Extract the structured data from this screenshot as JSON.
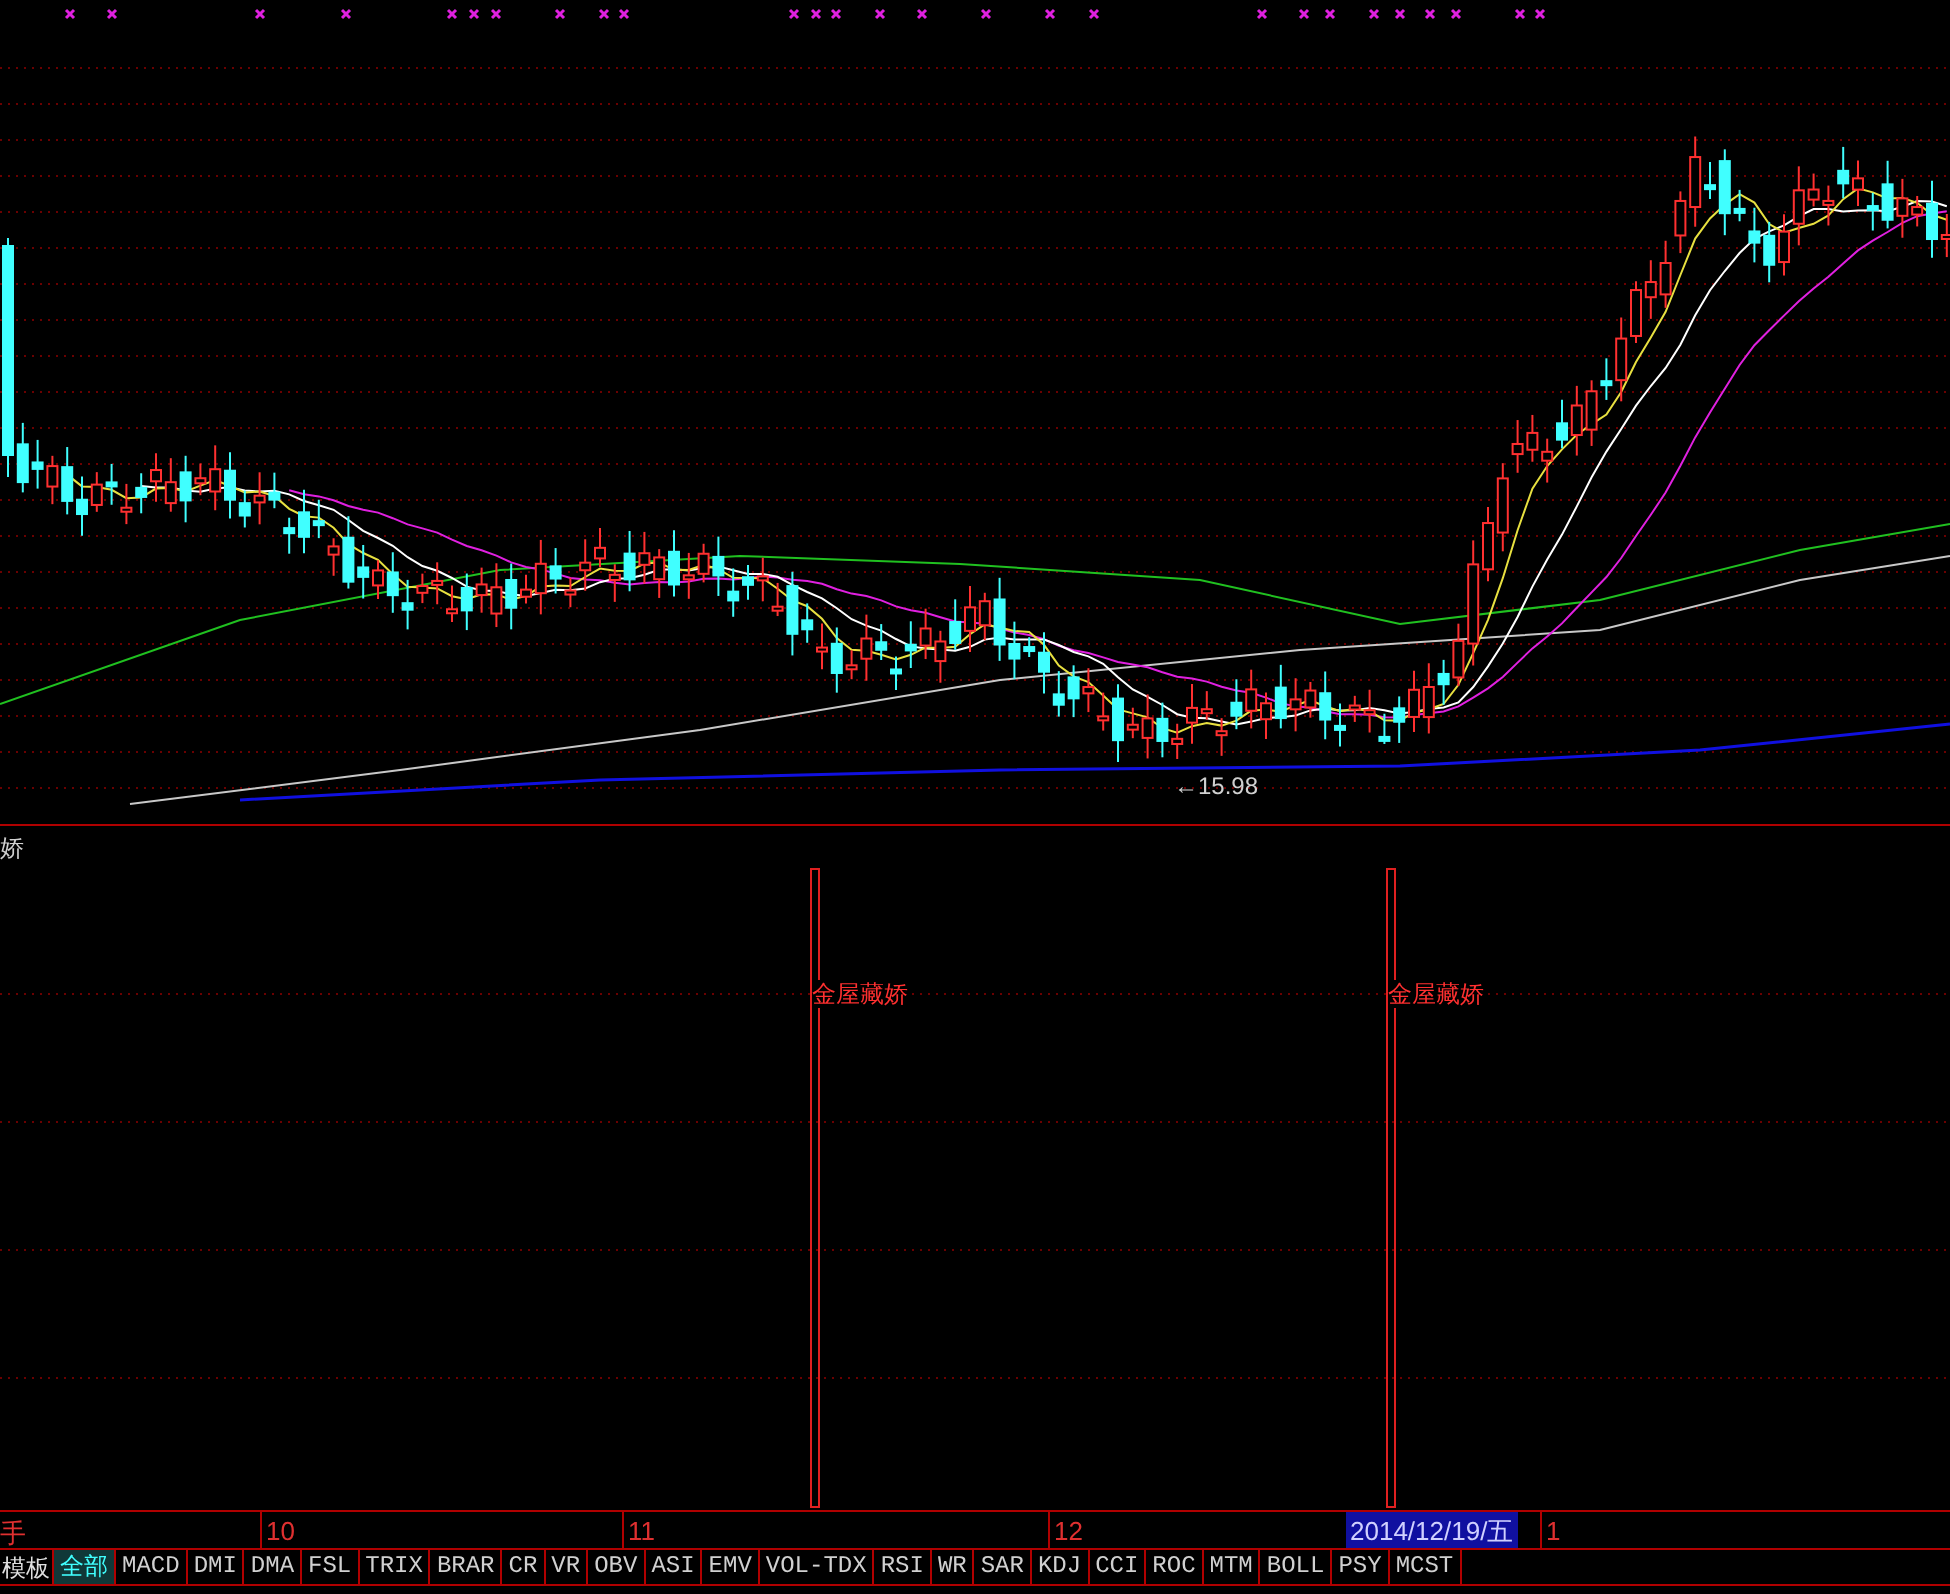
{
  "main_chart": {
    "low_label": "←15.98"
  },
  "indicator_panel": {
    "title": "娇",
    "signals": [
      {
        "label": "金屋藏娇"
      },
      {
        "label": "金屋藏娇"
      }
    ]
  },
  "date_axis": {
    "unit_label": "手",
    "ticks": [
      "10",
      "11",
      "12",
      "1"
    ],
    "cursor_date": "2014/12/19/五"
  },
  "tab_bar": {
    "template_label": "模板",
    "tabs": [
      {
        "label": "全部",
        "selected": true
      },
      {
        "label": "MACD",
        "selected": false
      },
      {
        "label": "DMI",
        "selected": false
      },
      {
        "label": "DMA",
        "selected": false
      },
      {
        "label": "FSL",
        "selected": false
      },
      {
        "label": "TRIX",
        "selected": false
      },
      {
        "label": "BRAR",
        "selected": false
      },
      {
        "label": "CR",
        "selected": false
      },
      {
        "label": "VR",
        "selected": false
      },
      {
        "label": "OBV",
        "selected": false
      },
      {
        "label": "ASI",
        "selected": false
      },
      {
        "label": "EMV",
        "selected": false
      },
      {
        "label": "VOL-TDX",
        "selected": false
      },
      {
        "label": "RSI",
        "selected": false
      },
      {
        "label": "WR",
        "selected": false
      },
      {
        "label": "SAR",
        "selected": false
      },
      {
        "label": "KDJ",
        "selected": false
      },
      {
        "label": "CCI",
        "selected": false
      },
      {
        "label": "ROC",
        "selected": false
      },
      {
        "label": "MTM",
        "selected": false
      },
      {
        "label": "BOLL",
        "selected": false
      },
      {
        "label": "PSY",
        "selected": false
      },
      {
        "label": "MCST",
        "selected": false
      }
    ]
  }
}
